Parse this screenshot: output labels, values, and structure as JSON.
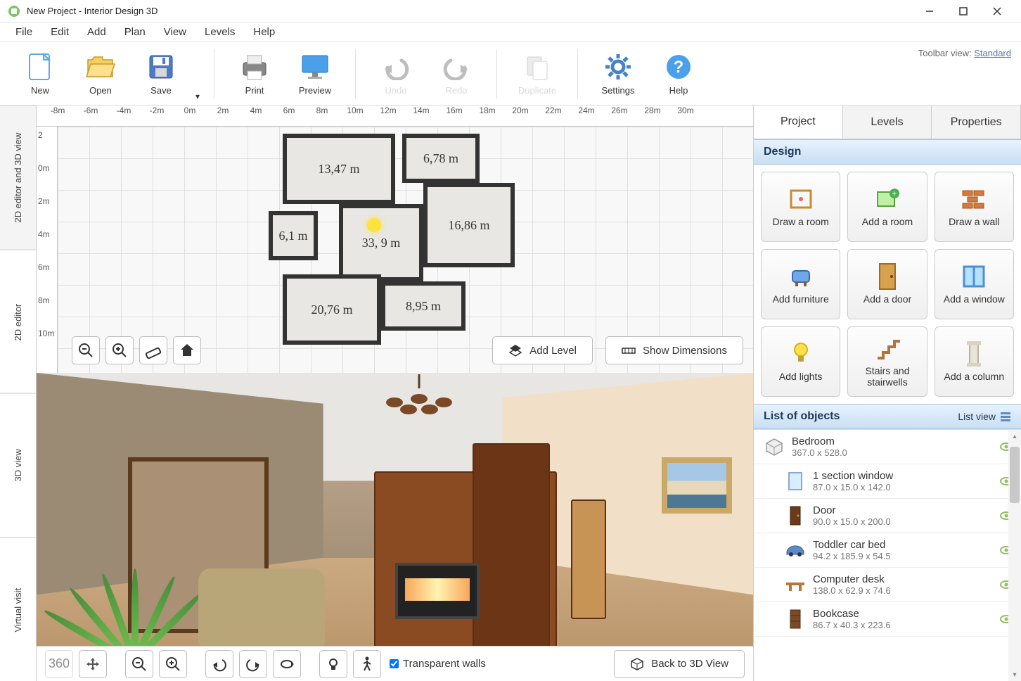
{
  "window": {
    "title": "New Project - Interior Design 3D"
  },
  "menubar": {
    "items": [
      "File",
      "Edit",
      "Add",
      "Plan",
      "View",
      "Levels",
      "Help"
    ]
  },
  "toolbar": {
    "view_label": "Toolbar view:",
    "view_link": "Standard",
    "buttons": {
      "new": "New",
      "open": "Open",
      "save": "Save",
      "print": "Print",
      "preview": "Preview",
      "undo": "Undo",
      "redo": "Redo",
      "duplicate": "Duplicate",
      "settings": "Settings",
      "help": "Help"
    }
  },
  "vtabs": {
    "combined": "2D editor and 3D view",
    "editor2d": "2D editor",
    "view3d": "3D view",
    "virtual": "Virtual visit"
  },
  "ruler_h": {
    "ticks": [
      "-8m",
      "-6m",
      "-4m",
      "-2m",
      "0m",
      "2m",
      "4m",
      "6m",
      "8m",
      "10m",
      "12m",
      "14m",
      "16m",
      "18m",
      "20m",
      "22m",
      "24m",
      "26m",
      "28m",
      "30m"
    ]
  },
  "ruler_v": {
    "ticks": [
      "2",
      "0m",
      "2m",
      "4m",
      "6m",
      "8m",
      "10m"
    ]
  },
  "floorplan": {
    "labels": [
      "13,47 m",
      "6,78 m",
      "33,  9 m",
      "16,86 m",
      "6,1 m",
      "20,76 m",
      "8,95 m"
    ]
  },
  "plan_buttons": {
    "add_level": "Add Level",
    "show_dims": "Show Dimensions"
  },
  "render_bottom": {
    "transparent_walls": "Transparent walls",
    "back_3d": "Back to 3D View"
  },
  "right_tabs": {
    "project": "Project",
    "levels": "Levels",
    "properties": "Properties"
  },
  "design": {
    "header": "Design",
    "buttons": [
      {
        "id": "draw-room",
        "label": "Draw a room"
      },
      {
        "id": "add-room",
        "label": "Add a room"
      },
      {
        "id": "draw-wall",
        "label": "Draw a wall"
      },
      {
        "id": "add-furniture",
        "label": "Add furniture"
      },
      {
        "id": "add-door",
        "label": "Add a door"
      },
      {
        "id": "add-window",
        "label": "Add a window"
      },
      {
        "id": "add-lights",
        "label": "Add lights"
      },
      {
        "id": "stairs",
        "label": "Stairs and stairwells"
      },
      {
        "id": "add-column",
        "label": "Add a column"
      }
    ]
  },
  "objects": {
    "header": "List of objects",
    "list_view": "List view",
    "items": [
      {
        "name": "Bedroom",
        "dims": "367.0 x 528.0",
        "indent": false,
        "icon": "cube"
      },
      {
        "name": "1 section window",
        "dims": "87.0 x 15.0 x 142.0",
        "indent": true,
        "icon": "window"
      },
      {
        "name": "Door",
        "dims": "90.0 x 15.0 x 200.0",
        "indent": true,
        "icon": "door"
      },
      {
        "name": "Toddler car bed",
        "dims": "94.2 x 185.9 x 54.5",
        "indent": true,
        "icon": "car"
      },
      {
        "name": "Computer desk",
        "dims": "138.0 x 62.9 x 74.6",
        "indent": true,
        "icon": "desk"
      },
      {
        "name": "Bookcase",
        "dims": "86.7 x 40.3 x 223.6",
        "indent": true,
        "icon": "bookcase"
      }
    ]
  }
}
